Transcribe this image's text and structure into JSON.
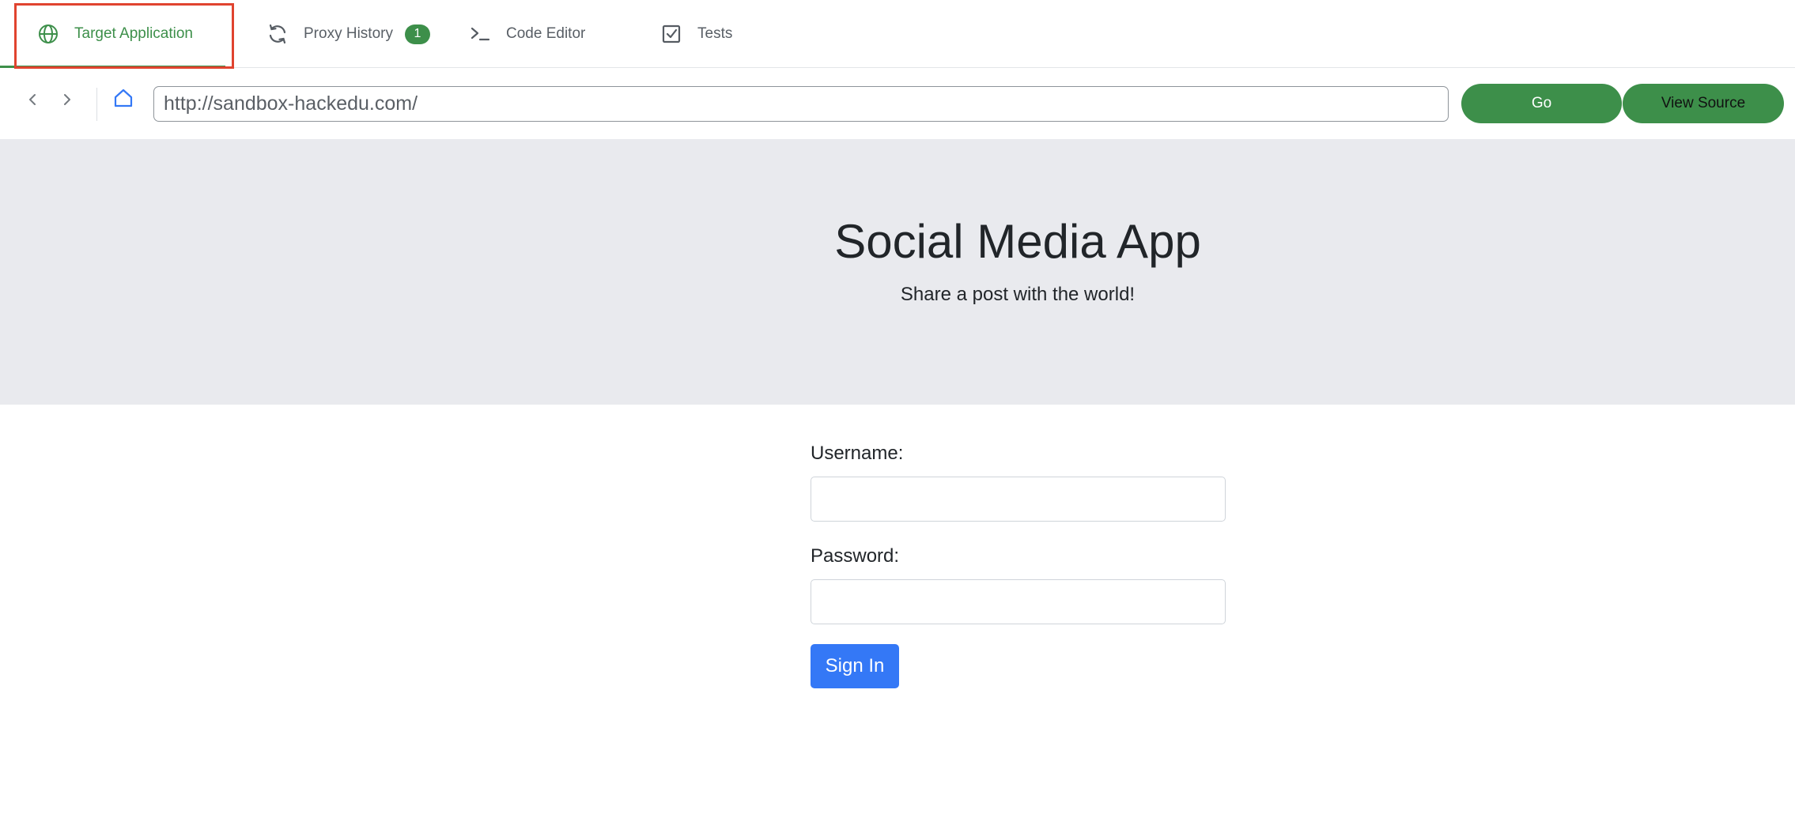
{
  "tabs": {
    "target": {
      "label": "Target Application",
      "icon": "globe-icon",
      "active": true
    },
    "proxy": {
      "label": "Proxy History",
      "icon": "refresh-icon",
      "badge": "1"
    },
    "code": {
      "label": "Code Editor",
      "icon": "terminal-icon"
    },
    "tests": {
      "label": "Tests",
      "icon": "checkbox-icon"
    }
  },
  "address_bar": {
    "url": "http://sandbox-hackedu.com/",
    "go_label": "Go",
    "view_source_label": "View Source"
  },
  "page": {
    "title": "Social Media App",
    "subtitle": "Share a post with the world!",
    "username_label": "Username:",
    "username_value": "",
    "password_label": "Password:",
    "password_value": "",
    "signin_label": "Sign In"
  },
  "colors": {
    "accent_green": "#3d8f4a",
    "highlight_red": "#e0432f",
    "primary_blue": "#3478f6",
    "hero_background": "#e9eaee"
  }
}
